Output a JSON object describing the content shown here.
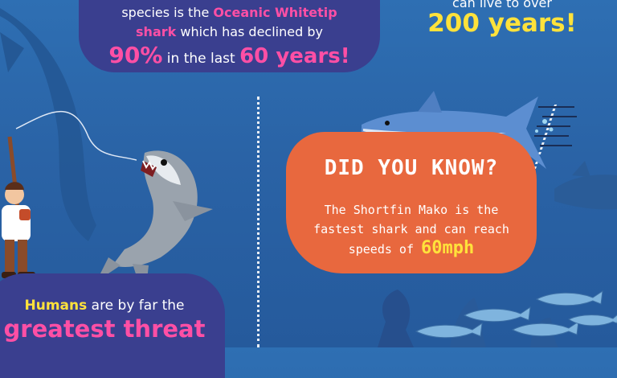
{
  "top_panel": {
    "line1": "species is the ",
    "line1_highlight": "Oceanic Whitetip",
    "line2_highlight": "shark",
    "line2": " which has declined by",
    "percent": "90%",
    "line3_mid": " in the last ",
    "years": "60 years!"
  },
  "top_right": {
    "line1": "can live to over",
    "highlight": "200 years!"
  },
  "fact_card": {
    "title": "DID YOU KNOW?",
    "line1": "The Shortfin Mako is the",
    "line2": "fastest shark and can reach",
    "line3_prefix": "speeds of ",
    "speed": "60mph"
  },
  "bottom_panel": {
    "prefix_highlight": "Humans",
    "line1": " are by far the",
    "big_highlight": "greatest threat"
  },
  "colors": {
    "ocean": "#2a63a6",
    "panel_purple": "#3a3f8f",
    "card_orange": "#e8683e",
    "pink": "#ff4fa5",
    "yellow": "#ffe23b"
  },
  "icons": {
    "fisherman": "fisherman-illustration",
    "jumping_shark": "shark-illustration",
    "mako_shark": "mako-shark-illustration",
    "fish_school": "fish-school-illustration"
  }
}
